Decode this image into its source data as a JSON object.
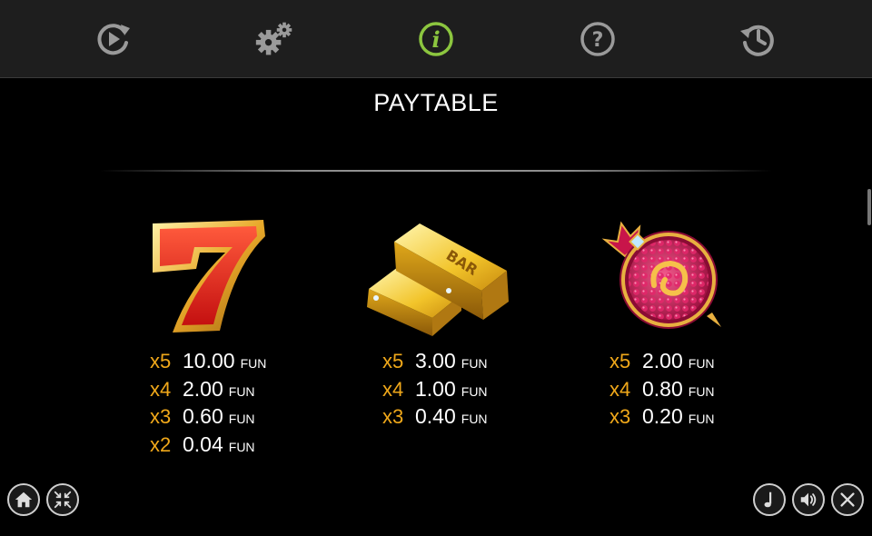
{
  "topbar": {
    "buttons": [
      {
        "name": "autoplay",
        "icon": "autoplay-icon"
      },
      {
        "name": "settings",
        "icon": "gears-icon"
      },
      {
        "name": "info",
        "icon": "info-icon",
        "active": true
      },
      {
        "name": "help",
        "icon": "question-icon"
      },
      {
        "name": "history",
        "icon": "history-icon"
      }
    ],
    "active_color": "#8cc63f",
    "icon_color": "#9a9a9a"
  },
  "page": {
    "title": "PAYTABLE"
  },
  "symbols": [
    {
      "name": "seven",
      "icon": "red-seven-icon",
      "pays": [
        {
          "mult": "x5",
          "amount": "10.00",
          "currency": "FUN"
        },
        {
          "mult": "x4",
          "amount": "2.00",
          "currency": "FUN"
        },
        {
          "mult": "x3",
          "amount": "0.60",
          "currency": "FUN"
        },
        {
          "mult": "x2",
          "amount": "0.04",
          "currency": "FUN"
        }
      ]
    },
    {
      "name": "gold-bar",
      "icon": "gold-bar-icon",
      "bar_text": "BAR",
      "pays": [
        {
          "mult": "x5",
          "amount": "3.00",
          "currency": "FUN"
        },
        {
          "mult": "x4",
          "amount": "1.00",
          "currency": "FUN"
        },
        {
          "mult": "x3",
          "amount": "0.40",
          "currency": "FUN"
        }
      ]
    },
    {
      "name": "pomegranate",
      "icon": "pomegranate-icon",
      "pays": [
        {
          "mult": "x5",
          "amount": "2.00",
          "currency": "FUN"
        },
        {
          "mult": "x4",
          "amount": "0.80",
          "currency": "FUN"
        },
        {
          "mult": "x3",
          "amount": "0.20",
          "currency": "FUN"
        }
      ]
    }
  ],
  "bottom_left": [
    {
      "name": "home",
      "icon": "home-icon"
    },
    {
      "name": "exit-fullscreen",
      "icon": "compress-icon"
    }
  ],
  "bottom_right": [
    {
      "name": "music",
      "icon": "music-note-icon"
    },
    {
      "name": "sound",
      "icon": "speaker-icon"
    },
    {
      "name": "close",
      "icon": "close-icon"
    }
  ],
  "colors": {
    "multiplier": "#f0a81a",
    "value": "#ffffff",
    "background": "#000000",
    "topbar": "#1e1e1e"
  }
}
